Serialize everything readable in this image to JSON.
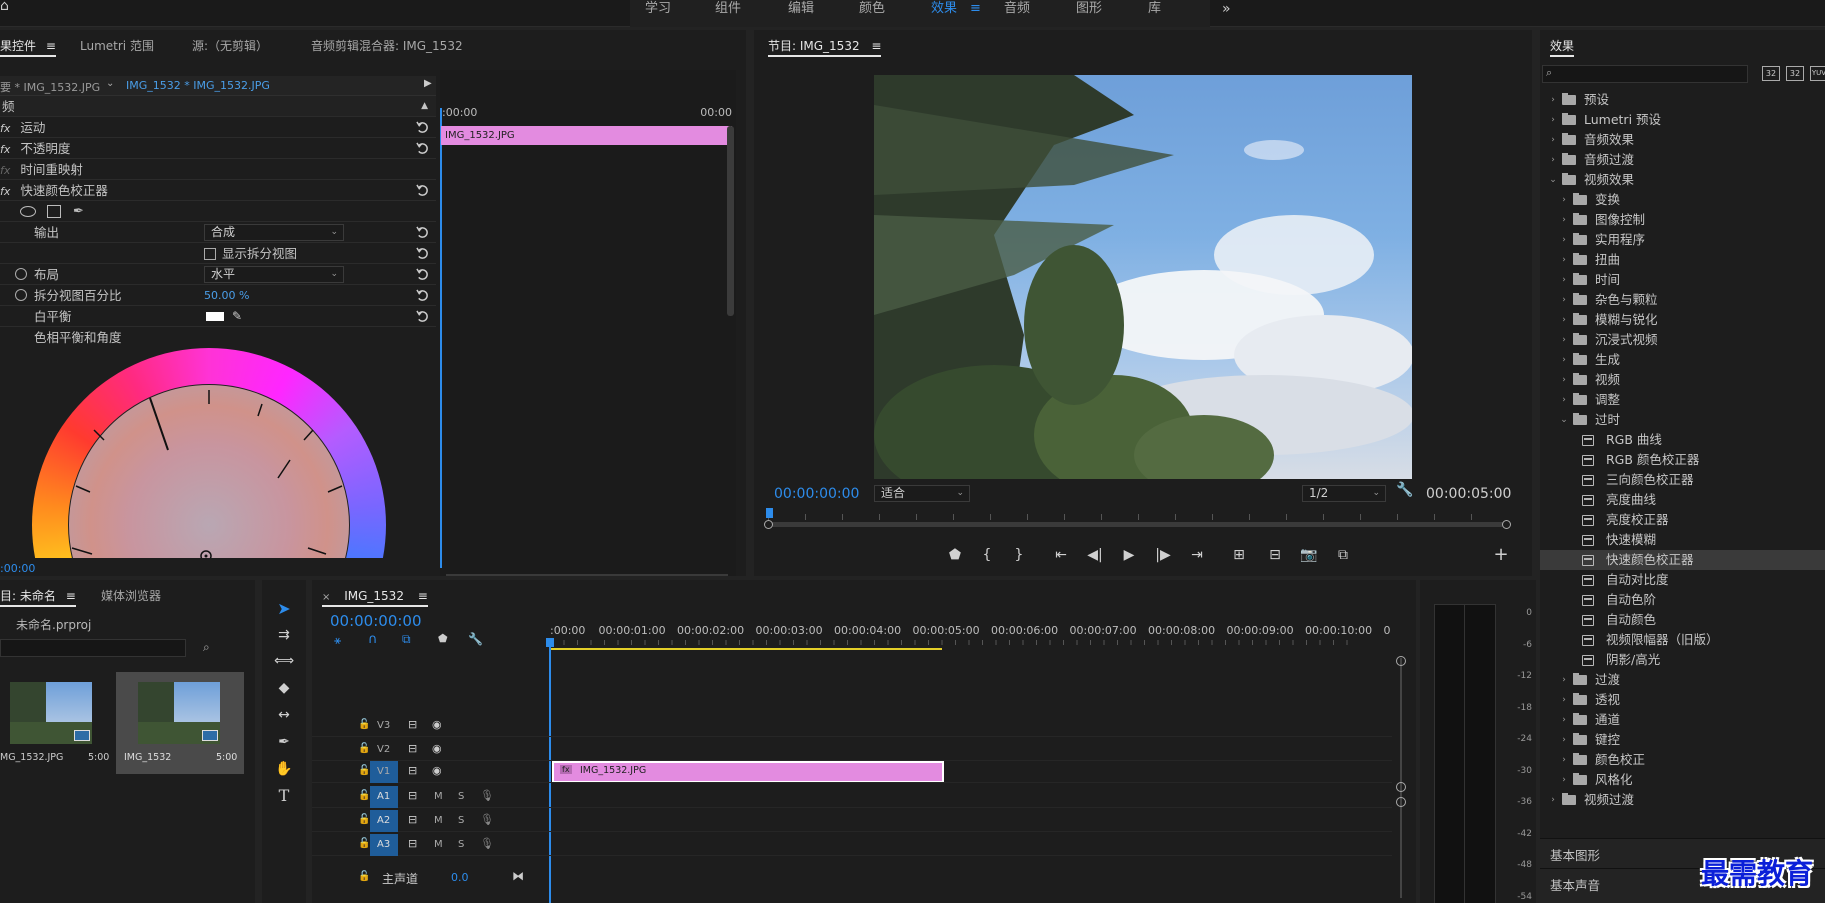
{
  "workspace_tabs": [
    "学习",
    "组件",
    "编辑",
    "颜色",
    "效果",
    "音频",
    "图形",
    "库"
  ],
  "workspace_active": "效果",
  "workspace_overflow": "»",
  "effect_controls": {
    "tabs": [
      "果控件",
      "Lumetri 范围",
      "源:（无剪辑）",
      "音频剪辑混合器: IMG_1532"
    ],
    "menu_icon": "≡",
    "master_label": "要 * IMG_1532.JPG",
    "clip_label": "IMG_1532 * IMG_1532.JPG",
    "section": "频",
    "effects": [
      "运动",
      "不透明度",
      "时间重映射",
      "快速颜色校正器"
    ],
    "output_label": "输出",
    "output_value": "合成",
    "split_view_label": "显示拆分视图",
    "layout_label": "布局",
    "layout_value": "水平",
    "split_pct_label": "拆分视图百分比",
    "split_pct_value": "50.00 %",
    "white_balance_label": "白平衡",
    "hue_angle_label": "色相平衡和角度",
    "mini_ruler_start": ":00:00",
    "mini_ruler_end": "00:00",
    "mini_clip": "IMG_1532.JPG",
    "timecode": ":00:00"
  },
  "program_monitor": {
    "title": "节目: IMG_1532",
    "timecode": "00:00:00:00",
    "fit_value": "适合",
    "resolution": "1/2",
    "duration": "00:00:05:00"
  },
  "effects_panel": {
    "title": "效果",
    "toolbar_icons": [
      "32",
      "32",
      "YUV"
    ],
    "tree": [
      {
        "label": "预设",
        "level": 0,
        "kind": "folder",
        "arrow": "›"
      },
      {
        "label": "Lumetri 预设",
        "level": 0,
        "kind": "folder",
        "arrow": "›"
      },
      {
        "label": "音频效果",
        "level": 0,
        "kind": "folder",
        "arrow": "›"
      },
      {
        "label": "音频过渡",
        "level": 0,
        "kind": "folder",
        "arrow": "›"
      },
      {
        "label": "视频效果",
        "level": 0,
        "kind": "folder",
        "arrow": "⌄"
      },
      {
        "label": "变换",
        "level": 1,
        "kind": "folder",
        "arrow": "›"
      },
      {
        "label": "图像控制",
        "level": 1,
        "kind": "folder",
        "arrow": "›"
      },
      {
        "label": "实用程序",
        "level": 1,
        "kind": "folder",
        "arrow": "›"
      },
      {
        "label": "扭曲",
        "level": 1,
        "kind": "folder",
        "arrow": "›"
      },
      {
        "label": "时间",
        "level": 1,
        "kind": "folder",
        "arrow": "›"
      },
      {
        "label": "杂色与颗粒",
        "level": 1,
        "kind": "folder",
        "arrow": "›"
      },
      {
        "label": "模糊与锐化",
        "level": 1,
        "kind": "folder",
        "arrow": "›"
      },
      {
        "label": "沉浸式视频",
        "level": 1,
        "kind": "folder",
        "arrow": "›"
      },
      {
        "label": "生成",
        "level": 1,
        "kind": "folder",
        "arrow": "›"
      },
      {
        "label": "视频",
        "level": 1,
        "kind": "folder",
        "arrow": "›"
      },
      {
        "label": "调整",
        "level": 1,
        "kind": "folder",
        "arrow": "›"
      },
      {
        "label": "过时",
        "level": 1,
        "kind": "folder",
        "arrow": "⌄"
      },
      {
        "label": "RGB 曲线",
        "level": 2,
        "kind": "effect",
        "arrow": ""
      },
      {
        "label": "RGB 颜色校正器",
        "level": 2,
        "kind": "effect",
        "arrow": ""
      },
      {
        "label": "三向颜色校正器",
        "level": 2,
        "kind": "effect",
        "arrow": ""
      },
      {
        "label": "亮度曲线",
        "level": 2,
        "kind": "effect",
        "arrow": ""
      },
      {
        "label": "亮度校正器",
        "level": 2,
        "kind": "effect",
        "arrow": ""
      },
      {
        "label": "快速模糊",
        "level": 2,
        "kind": "effect",
        "arrow": ""
      },
      {
        "label": "快速颜色校正器",
        "level": 2,
        "kind": "effect",
        "arrow": "",
        "selected": true
      },
      {
        "label": "自动对比度",
        "level": 2,
        "kind": "effect",
        "arrow": ""
      },
      {
        "label": "自动色阶",
        "level": 2,
        "kind": "effect",
        "arrow": ""
      },
      {
        "label": "自动颜色",
        "level": 2,
        "kind": "effect",
        "arrow": ""
      },
      {
        "label": "视频限幅器（旧版）",
        "level": 2,
        "kind": "effect",
        "arrow": ""
      },
      {
        "label": "阴影/高光",
        "level": 2,
        "kind": "effect",
        "arrow": ""
      },
      {
        "label": "过渡",
        "level": 1,
        "kind": "folder",
        "arrow": "›"
      },
      {
        "label": "透视",
        "level": 1,
        "kind": "folder",
        "arrow": "›"
      },
      {
        "label": "通道",
        "level": 1,
        "kind": "folder",
        "arrow": "›"
      },
      {
        "label": "键控",
        "level": 1,
        "kind": "folder",
        "arrow": "›"
      },
      {
        "label": "颜色校正",
        "level": 1,
        "kind": "folder",
        "arrow": "›"
      },
      {
        "label": "风格化",
        "level": 1,
        "kind": "folder",
        "arrow": "›"
      },
      {
        "label": "视频过渡",
        "level": 0,
        "kind": "folder",
        "arrow": "›"
      }
    ],
    "bottom_items": [
      "基本图形",
      "基本声音"
    ]
  },
  "project_panel": {
    "tabs": [
      "目: 未命名",
      "媒体浏览器"
    ],
    "menu_icon": "≡",
    "project_file": "未命名.prproj",
    "items": [
      {
        "name": "MG_1532.JPG",
        "duration": "5:00"
      },
      {
        "name": "IMG_1532",
        "duration": "5:00"
      }
    ]
  },
  "timeline": {
    "tab": "IMG_1532",
    "menu_icon": "≡",
    "timecode": "00:00:00:00",
    "ruler": [
      ":00:00",
      "00:00:01:00",
      "00:00:02:00",
      "00:00:03:00",
      "00:00:04:00",
      "00:00:05:00",
      "00:00:06:00",
      "00:00:07:00",
      "00:00:08:00",
      "00:00:09:00",
      "00:00:10:00",
      "0"
    ],
    "video_tracks": [
      "V3",
      "V2",
      "V1"
    ],
    "audio_tracks": [
      "A1",
      "A2",
      "A3"
    ],
    "track_m": "M",
    "track_s": "S",
    "master_label": "主声道",
    "master_value": "0.0",
    "clip_label": "IMG_1532.JPG",
    "clip_fx": "fx"
  },
  "audio_meter": {
    "labels": [
      "0",
      "-6",
      "-12",
      "-18",
      "-24",
      "-30",
      "-36",
      "-42",
      "-48",
      "-54"
    ]
  },
  "watermark": "最需教育",
  "colors": {
    "accent_blue": "#2d8ceb",
    "clip_pink": "#e38be0",
    "panel_bg": "#1d1d1d"
  }
}
